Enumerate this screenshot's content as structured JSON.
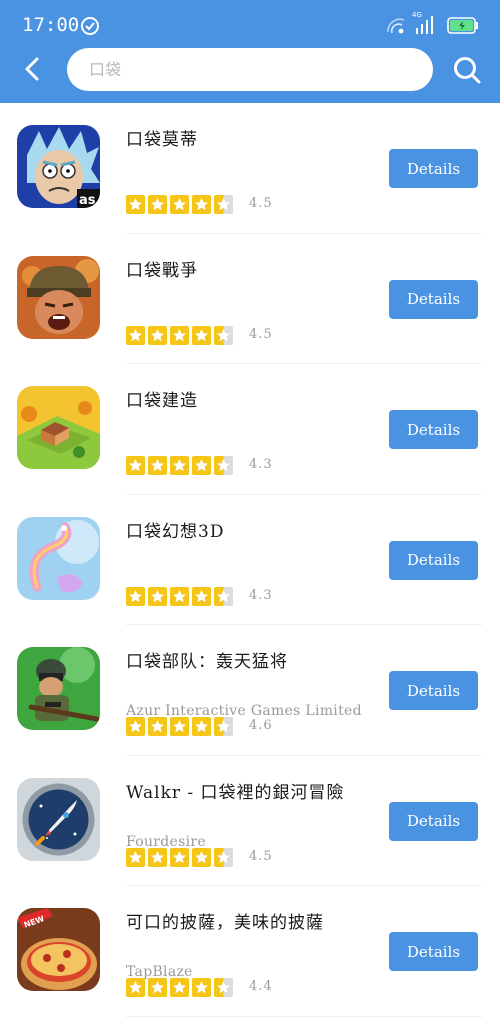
{
  "status": {
    "time": "17:00",
    "network": "4G"
  },
  "search": {
    "value": "",
    "placeholder": "口袋"
  },
  "apps": [
    {
      "title": "口袋莫蒂",
      "developer": "",
      "rating": "4.5",
      "stars": 4.5,
      "button": "Details",
      "icon": "rick-and-morty-icon"
    },
    {
      "title": "口袋戰爭",
      "developer": "",
      "rating": "4.5",
      "stars": 4.5,
      "button": "Details",
      "icon": "soldier-icon"
    },
    {
      "title": "口袋建造",
      "developer": "",
      "rating": "4.3",
      "stars": 4.5,
      "button": "Details",
      "icon": "farm-island-icon"
    },
    {
      "title": "口袋幻想3D",
      "developer": "",
      "rating": "4.3",
      "stars": 4.5,
      "button": "Details",
      "icon": "dragon-icon"
    },
    {
      "title": "口袋部队：轰天猛将",
      "developer": "Azur Interactive Games Limited",
      "rating": "4.6",
      "stars": 4.5,
      "button": "Details",
      "icon": "sniper-icon"
    },
    {
      "title": "Walkr - 口袋裡的銀河冒險",
      "developer": "Fourdesire",
      "rating": "4.5",
      "stars": 4.5,
      "button": "Details",
      "icon": "rocket-icon"
    },
    {
      "title": "可口的披薩，美味的披薩",
      "developer": "TapBlaze",
      "rating": "4.4",
      "stars": 4.5,
      "button": "Details",
      "icon": "pizza-icon"
    }
  ],
  "colors": {
    "header": "#4a92e2",
    "button": "#4a92e2",
    "star": "#f5c518"
  }
}
